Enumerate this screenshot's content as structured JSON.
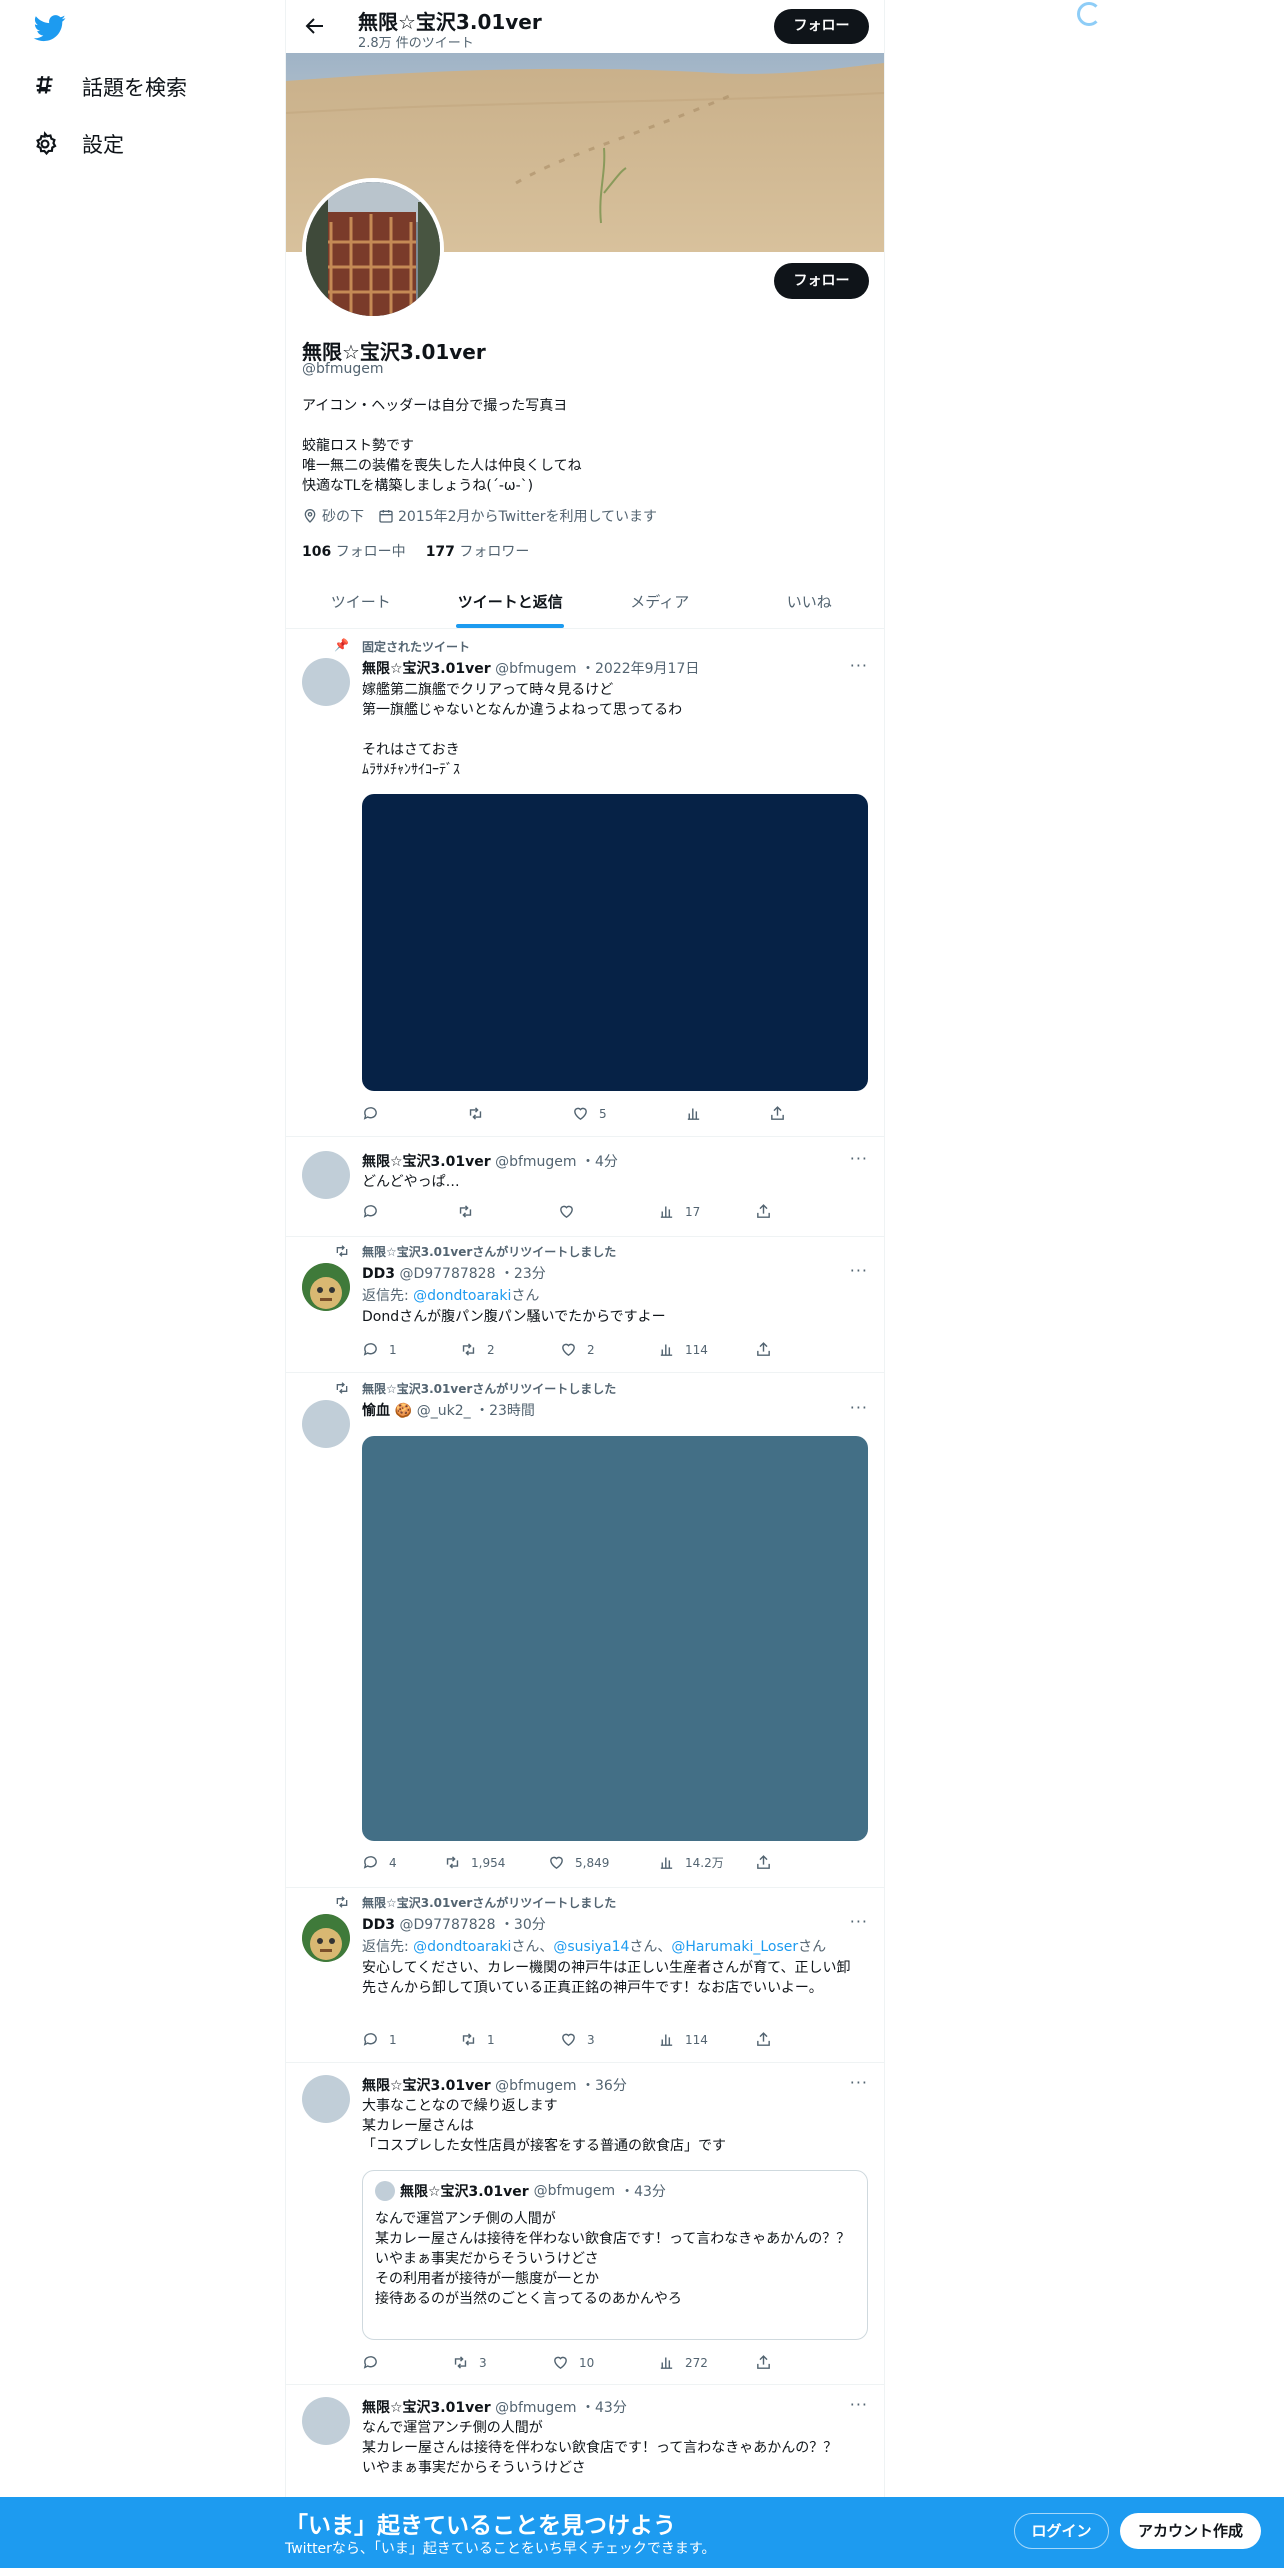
{
  "nav": {
    "explore_label": "話題を検索",
    "settings_label": "設定"
  },
  "topbar": {
    "name": "無限☆宝沢3.01ver",
    "tweet_count": "2.8万 件のツイート",
    "follow_label": "フォロー"
  },
  "profile": {
    "name": "無限☆宝沢3.01ver",
    "handle": "@bfmugem",
    "follow_label": "フォロー",
    "bio": "アイコン・ヘッダーは自分で撮った写真ヨ\n\n蛟龍ロスト勢です\n唯一無二の装備を喪失した人は仲良くしてね\n快適なTLを構築しましょうね(´-ω-`)",
    "location": "砂の下",
    "joined": "2015年2月からTwitterを利用しています",
    "following_count": "106",
    "following_label": "フォロー中",
    "followers_count": "177",
    "followers_label": "フォロワー"
  },
  "tabs": [
    "ツイート",
    "ツイートと返信",
    "メディア",
    "いいね"
  ],
  "tweets": [
    {
      "context": "固定されたツイート",
      "name": "無限☆宝沢3.01ver",
      "handle": "@bfmugem",
      "time": "・2022年9月17日",
      "text": "嫁艦第二旗艦でクリアって時々見るけど\n第一旗艦じゃないとなんか違うよねって思ってるわ\n\nそれはさておき\nﾑﾗｻﾒﾁｬﾝｻｲｺｰﾃﾞｽ",
      "reply": "",
      "retweet": "",
      "like": "5",
      "views": ""
    },
    {
      "context": "",
      "name": "無限☆宝沢3.01ver",
      "handle": "@bfmugem",
      "time": "・4分",
      "text": "どんどやっぱ…",
      "reply": "",
      "retweet": "",
      "like": "",
      "views": "17"
    },
    {
      "context": "無限☆宝沢3.01verさんがリツイートしました",
      "name": "DD3",
      "handle": "@D97787828",
      "time": "・23分",
      "reply_prefix": "返信先: ",
      "reply_to": "@dondtoaraki",
      "reply_suffix": "さん",
      "text": "Dondさんが腹パン腹パン騒いでたからですよー",
      "reply": "1",
      "retweet": "2",
      "like": "2",
      "views": "114"
    },
    {
      "context": "無限☆宝沢3.01verさんがリツイートしました",
      "name": "愉血 🍪",
      "handle": "@_uk2_",
      "time": "・23時間",
      "text": "",
      "reply": "4",
      "retweet": "1,954",
      "like": "5,849",
      "views": "14.2万"
    },
    {
      "context": "無限☆宝沢3.01verさんがリツイートしました",
      "name": "DD3",
      "handle": "@D97787828",
      "time": "・30分",
      "reply_prefix": "返信先: ",
      "reply_to_1": "@dondtoaraki",
      "reply_sep_1": "さん、",
      "reply_to_2": "@susiya14",
      "reply_sep_2": "さん、",
      "reply_to_3": "@Harumaki_Loser",
      "reply_suffix": "さん",
      "text": "安心してください、カレー機関の神戸牛は正しい生産者さんが育て、正しい卸先さんから卸して頂いている正真正銘の神戸牛です！なお店でいいよー。",
      "reply": "1",
      "retweet": "1",
      "like": "3",
      "views": "114"
    },
    {
      "context": "",
      "name": "無限☆宝沢3.01ver",
      "handle": "@bfmugem",
      "time": "・36分",
      "text": "大事なことなので繰り返します\n某カレー屋さんは\n「コスプレした女性店員が接客をする普通の飲食店」です",
      "quote": {
        "name": "無限☆宝沢3.01ver",
        "handle": "@bfmugem",
        "time": "・43分",
        "text": "なんで運営アンチ側の人間が\n某カレー屋さんは接待を伴わない飲食店です！って言わなきゃあかんの？？\nいやまぁ事実だからそういうけどさ\nその利用者が接待が一態度が一とか\n接待あるのが当然のごとく言ってるのあかんやろ"
      },
      "reply": "",
      "retweet": "3",
      "like": "10",
      "views": "272"
    },
    {
      "context": "",
      "name": "無限☆宝沢3.01ver",
      "handle": "@bfmugem",
      "time": "・43分",
      "text": "なんで運営アンチ側の人間が\n某カレー屋さんは接待を伴わない飲食店です！って言わなきゃあかんの？？\nいやまぁ事実だからそういうけどさ"
    }
  ],
  "bottombar": {
    "title": "「いま」起きていることを見つけよう",
    "subtitle": "Twitterなら、「いま」起きていることをいち早くチェックできます。",
    "login_label": "ログイン",
    "signup_label": "アカウント作成"
  },
  "colors": {
    "accent": "#1d9bf0",
    "media_1": "#062246",
    "media_2": "#436f86"
  }
}
